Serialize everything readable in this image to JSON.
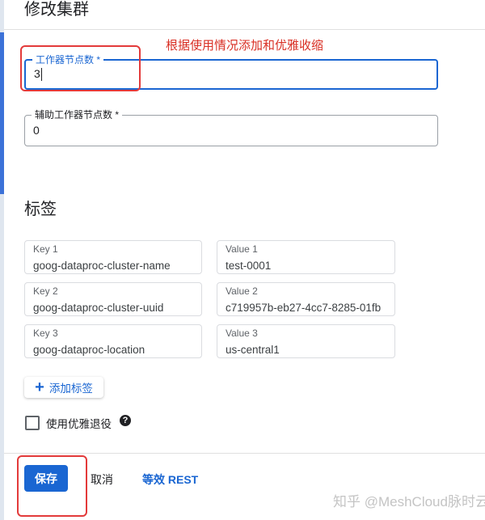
{
  "dialog": {
    "title": "修改集群"
  },
  "annotation": {
    "text": "根据使用情况添加和优雅收缩",
    "color": "#d93025"
  },
  "fields": {
    "workers": {
      "label": "工作器节点数 *",
      "value": "3"
    },
    "secondary_workers": {
      "label": "辅助工作器节点数 *",
      "value": "0"
    }
  },
  "labels_section": {
    "title": "标签",
    "rows": [
      {
        "key_label": "Key 1",
        "key_value": "goog-dataproc-cluster-name",
        "value_label": "Value 1",
        "value_value": "test-0001"
      },
      {
        "key_label": "Key 2",
        "key_value": "goog-dataproc-cluster-uuid",
        "value_label": "Value 2",
        "value_value": "c719957b-eb27-4cc7-8285-01fb"
      },
      {
        "key_label": "Key 3",
        "key_value": "goog-dataproc-location",
        "value_label": "Value 3",
        "value_value": "us-central1"
      }
    ],
    "add_button": "添加标签"
  },
  "graceful_decommission": {
    "label": "使用优雅退役",
    "checked": false
  },
  "footer": {
    "save": "保存",
    "cancel": "取消",
    "rest": "等效 REST"
  },
  "watermark": "知乎 @MeshCloud脉时云",
  "colors": {
    "primary": "#1a66d2",
    "highlight": "#e33a3a"
  }
}
